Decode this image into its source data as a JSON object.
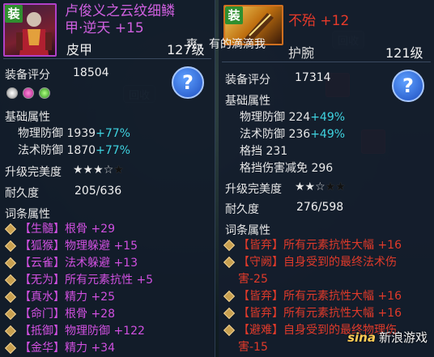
{
  "left": {
    "badge": "装",
    "title_line1": "卢俊义之云纹细鳞",
    "title_line2": "甲·逆天 +15",
    "slot": "皮甲",
    "level": "127级",
    "score_label": "装备评分",
    "score_value": "18504",
    "help": "?",
    "base_label": "基础属性",
    "base": [
      {
        "name": "物理防御",
        "value": "1939",
        "bonus": "+77%"
      },
      {
        "name": "法术防御",
        "value": "1870",
        "bonus": "+77%"
      }
    ],
    "perfection_label": "升级完美度",
    "stars": "★★★☆★",
    "durability_label": "耐久度",
    "durability_value": "205/636",
    "affix_label": "词条属性",
    "affixes": [
      "【生髓】根骨 +29",
      "【狐猴】物理躲避 +15",
      "【云雀】法术躲避 +13",
      "【无为】所有元素抗性 +5",
      "【真水】精力 +25",
      "【命门】根骨 +28",
      "【抵御】物理防御 +122",
      "【金华】精力 +34"
    ]
  },
  "right": {
    "badge": "装",
    "title": "不殆 +12",
    "slot": "护腕",
    "level": "121级",
    "score_label": "装备评分",
    "score_value": "17314",
    "help": "?",
    "base_label": "基础属性",
    "base": [
      {
        "name": "物理防御",
        "value": "224",
        "bonus": "+49%"
      },
      {
        "name": "法术防御",
        "value": "236",
        "bonus": "+49%"
      },
      {
        "name": "格挡",
        "value": "231",
        "bonus": ""
      },
      {
        "name": "格挡伤害减免",
        "value": "296",
        "bonus": ""
      }
    ],
    "perfection_label": "升级完美度",
    "stars": "★★☆★★",
    "durability_label": "耐久度",
    "durability_value": "276/598",
    "affix_label": "词条属性",
    "affixes": [
      "【皆弃】所有元素抗性大幅 +16",
      "【守阙】自身受到的最终法术伤",
      "害-25",
      "【皆弃】所有元素抗性大幅 +16",
      "【皆弃】所有元素抗性大幅 +16",
      "【避难】自身受到的最终物理伤",
      "害-15"
    ]
  },
  "chat_text": "爽，有的滴滴我",
  "watermark": {
    "logo": "sina",
    "text": "新浪游戏"
  }
}
